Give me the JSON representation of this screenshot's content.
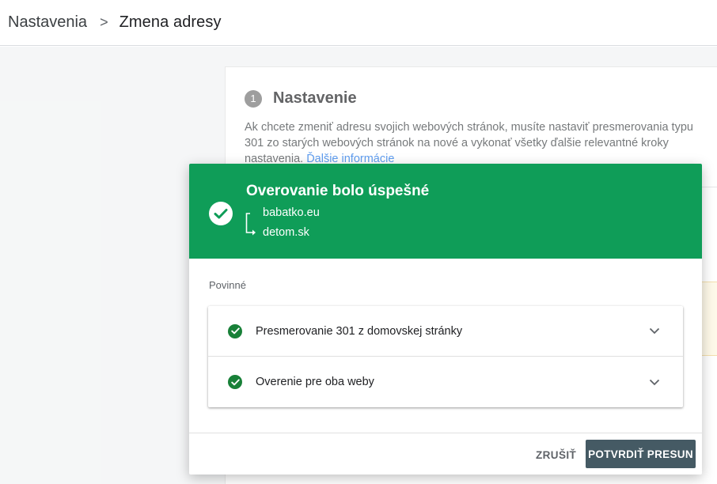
{
  "breadcrumb": {
    "root": "Nastavenia",
    "separator": ">",
    "current": "Zmena adresy"
  },
  "setup": {
    "step_number": "1",
    "title": "Nastavenie",
    "description": "Ak chcete zmeniť adresu svojich webových stránok, musíte nastaviť presmerovania typu 301 zo starých webových stránok na nové a vykonať všetky ďalšie relevantné kroky nastavenia.",
    "link": "Ďalšie informácie"
  },
  "dialog": {
    "title": "Overovanie bolo úspešné",
    "from_domain": "babatko.eu",
    "to_domain": "detom.sk",
    "section_label": "Povinné",
    "checks": [
      {
        "label": "Presmerovanie 301 z domovskej stránky",
        "status": "passed"
      },
      {
        "label": "Overenie pre oba weby",
        "status": "passed"
      }
    ],
    "cancel_label": "ZRUŠIŤ",
    "confirm_label": "POTVRDIŤ PRESUN"
  },
  "colors": {
    "success_header": "#0f9d58",
    "check_green": "#188038",
    "confirm_button": "#455a64",
    "link": "#1a73e8"
  },
  "icons": {
    "header_check": "check-circle-icon",
    "redirect": "redirect-arrow-icon",
    "row_check": "check-circle-icon",
    "expand": "chevron-down-icon",
    "breadcrumb_separator": "chevron-right-icon"
  }
}
